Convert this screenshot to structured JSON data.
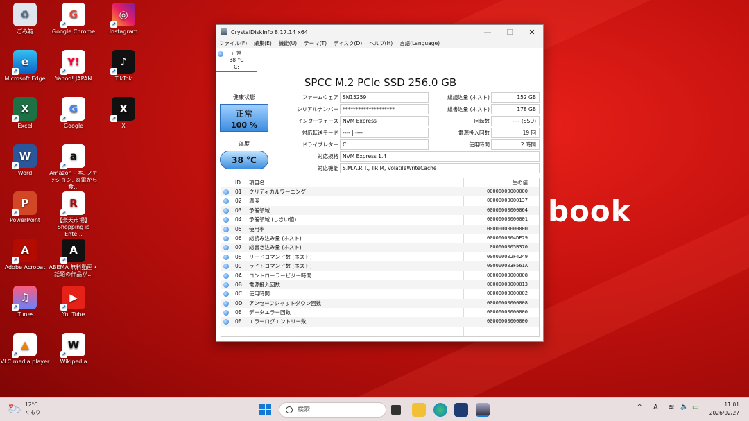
{
  "wallpaper": {
    "brand_text": "book"
  },
  "desktop": {
    "icons": [
      {
        "label": "ごみ箱",
        "icon": "recycle-bin-icon"
      },
      {
        "label": "Google Chrome",
        "icon": "chrome-icon"
      },
      {
        "label": "Instagram",
        "icon": "instagram-icon"
      },
      {
        "label": "Microsoft Edge",
        "icon": "edge-icon"
      },
      {
        "label": "Yahoo! JAPAN",
        "icon": "yahoo-icon"
      },
      {
        "label": "TikTok",
        "icon": "tiktok-icon"
      },
      {
        "label": "Excel",
        "icon": "excel-icon"
      },
      {
        "label": "Google",
        "icon": "google-icon"
      },
      {
        "label": "X",
        "icon": "x-icon"
      },
      {
        "label": "Word",
        "icon": "word-icon"
      },
      {
        "label": "Amazon ‐ 本, ファッション, 家電から食...",
        "icon": "amazon-icon"
      },
      {
        "label": "PowerPoint",
        "icon": "powerpoint-icon"
      },
      {
        "label": "【楽天市場】Shopping is Ente...",
        "icon": "rakuten-icon"
      },
      {
        "label": "Adobe Acrobat",
        "icon": "acrobat-icon"
      },
      {
        "label": "ABEMA 無料動画・話題の作品が...",
        "icon": "abema-icon"
      },
      {
        "label": "iTunes",
        "icon": "itunes-icon"
      },
      {
        "label": "YouTube",
        "icon": "youtube-icon"
      },
      {
        "label": "VLC media player",
        "icon": "vlc-icon"
      },
      {
        "label": "Wikipedia",
        "icon": "wikipedia-icon"
      }
    ],
    "icon_glyphs": {
      "chrome": "G",
      "yahoo": "Y!",
      "tiktok": "♪",
      "edge": "e",
      "excel": "X",
      "google": "G",
      "x": "X",
      "word": "W",
      "amazon": "a",
      "powerpoint": "P",
      "rakuten": "R",
      "acrobat": "A",
      "abema": "A",
      "itunes": "♫",
      "youtube": "▶",
      "vlc": "▲",
      "wikipedia": "W",
      "instagram": "◎",
      "recycle": "♻",
      "shortcut": "↗"
    }
  },
  "window": {
    "title": "CrystalDiskInfo 8.17.14 x64",
    "controls": {
      "minimize": "—",
      "maximize": "☐",
      "close": "✕"
    },
    "menu": [
      "ファイル(F)",
      "編集(E)",
      "機能(U)",
      "テーマ(T)",
      "ディスク(D)",
      "ヘルプ(H)",
      "言語(Language)"
    ],
    "disk_tab": {
      "status": "正常",
      "temp": "38 °C",
      "drive": "C:"
    },
    "model": "SPCC M.2 PCIe SSD 256.0 GB",
    "health": {
      "label": "健康状態",
      "status": "正常",
      "percent": "100 %"
    },
    "temperature": {
      "label": "温度",
      "value": "38 °C"
    },
    "info_left": [
      {
        "label": "ファームウェア",
        "value": "SN15259"
      },
      {
        "label": "シリアルナンバー",
        "value": "********************"
      },
      {
        "label": "インターフェース",
        "value": "NVM Express"
      },
      {
        "label": "対応転送モード",
        "value": "---- | ----"
      },
      {
        "label": "ドライブレター",
        "value": "C:"
      }
    ],
    "info_right": [
      {
        "label": "総読込量 (ホスト)",
        "value": "152 GB"
      },
      {
        "label": "総書込量 (ホスト)",
        "value": "178 GB"
      },
      {
        "label": "回転数",
        "value": "---- (SSD)"
      },
      {
        "label": "電源投入回数",
        "value": "19 回"
      },
      {
        "label": "使用時間",
        "value": "2 時間"
      }
    ],
    "standard": {
      "label": "対応規格",
      "value": "NVM Express 1.4"
    },
    "features": {
      "label": "対応機能",
      "value": "S.M.A.R.T., TRIM, VolatileWriteCache"
    },
    "table": {
      "headers": {
        "id": "ID",
        "name": "項目名",
        "raw": "生の値"
      },
      "rows": [
        {
          "id": "01",
          "name": "クリティカルワーニング",
          "raw": "00000000000000"
        },
        {
          "id": "02",
          "name": "温度",
          "raw": "00000000000137"
        },
        {
          "id": "03",
          "name": "予備領域",
          "raw": "00000000000064"
        },
        {
          "id": "04",
          "name": "予備領域 (しきい値)",
          "raw": "00000000000001"
        },
        {
          "id": "05",
          "name": "使用率",
          "raw": "00000000000000"
        },
        {
          "id": "06",
          "name": "総読み込み量 (ホスト)",
          "raw": "0000000004DE29"
        },
        {
          "id": "07",
          "name": "総書き込み量 (ホスト)",
          "raw": "000000005B370"
        },
        {
          "id": "08",
          "name": "リードコマンド数 (ホスト)",
          "raw": "000000002F4249"
        },
        {
          "id": "09",
          "name": "ライトコマンド数 (ホスト)",
          "raw": "000000003F561A"
        },
        {
          "id": "0A",
          "name": "コントローラービジー時間",
          "raw": "00000000000008"
        },
        {
          "id": "0B",
          "name": "電源投入回数",
          "raw": "00000000000013"
        },
        {
          "id": "0C",
          "name": "使用時間",
          "raw": "00000000000002"
        },
        {
          "id": "0D",
          "name": "アンセーフシャットダウン回数",
          "raw": "00000000000008"
        },
        {
          "id": "0E",
          "name": "データエラー回数",
          "raw": "00000000000000"
        },
        {
          "id": "0F",
          "name": "エラーログエントリー数",
          "raw": "00000000000000"
        }
      ]
    }
  },
  "taskbar": {
    "weather": {
      "temp": "12°C",
      "desc": "くもり",
      "badge": "1"
    },
    "search_placeholder": "検索",
    "tray": {
      "chevron": "^",
      "ime": "A",
      "wifi": "≋",
      "volume": "🔈",
      "battery": "▭"
    },
    "clock": {
      "time": "11:01",
      "date": "2026/02/27"
    }
  }
}
